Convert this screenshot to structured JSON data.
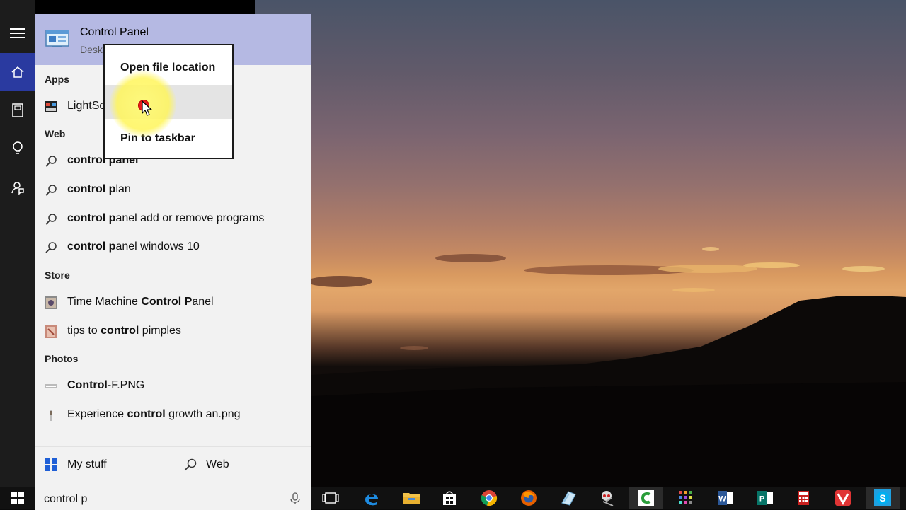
{
  "rail": {
    "items": [
      {
        "icon": "hamburger-menu-icon"
      },
      {
        "icon": "home-icon"
      },
      {
        "icon": "notebook-icon"
      },
      {
        "icon": "lightbulb-icon"
      },
      {
        "icon": "feedback-icon"
      }
    ]
  },
  "top_hit": {
    "title": "Control Panel",
    "subtitle": "Desk",
    "icon": "control-panel-icon"
  },
  "sections": {
    "apps": "Apps",
    "web": "Web",
    "store": "Store",
    "photos": "Photos"
  },
  "apps": [
    {
      "pre": "LightSc",
      "bold": "",
      "post": "",
      "icon": "lightscreen-app-icon"
    }
  ],
  "web": [
    {
      "bold": "control panel",
      "post": "",
      "icon": "search-icon"
    },
    {
      "bold": "control p",
      "post": "lan",
      "icon": "search-icon"
    },
    {
      "bold": "control p",
      "post": "anel add or remove programs",
      "icon": "search-icon"
    },
    {
      "bold": "control p",
      "post": "anel windows 10",
      "icon": "search-icon"
    }
  ],
  "store": [
    {
      "pre": "Time Machine ",
      "bold": "Control P",
      "post": "anel",
      "icon": "store-app-icon"
    },
    {
      "pre": "tips to ",
      "bold": "control",
      "post": " pimples",
      "icon": "store-app-icon"
    }
  ],
  "photos": [
    {
      "pre": "",
      "bold": "Control",
      "post": "-F.PNG",
      "icon": "image-thumbnail-icon"
    },
    {
      "pre": "Experience ",
      "bold": "control",
      "post": " growth an.png",
      "icon": "image-thumbnail-icon"
    }
  ],
  "bottom": {
    "my_stuff": "My stuff",
    "web": "Web"
  },
  "search": {
    "value": "control p"
  },
  "context_menu": {
    "items": [
      "Open file location",
      "",
      "Pin to taskbar"
    ]
  },
  "taskbar": {
    "icons": [
      "task-view-icon",
      "edge-icon",
      "file-explorer-icon",
      "store-icon",
      "chrome-icon",
      "firefox-icon",
      "paint-icon",
      "snipping-tool-icon",
      "camtasia-icon",
      "app-grid-icon",
      "word-icon",
      "publisher-icon",
      "calculator-icon",
      "vivaldi-icon",
      "skype-icon"
    ]
  },
  "colors": {
    "rail_bg": "#1c1c1c",
    "rail_active": "#2a3aa0",
    "top_hit_bg": "#b5b9e3",
    "panel_bg": "#f2f2f2",
    "taskbar_bg": "#111111"
  }
}
